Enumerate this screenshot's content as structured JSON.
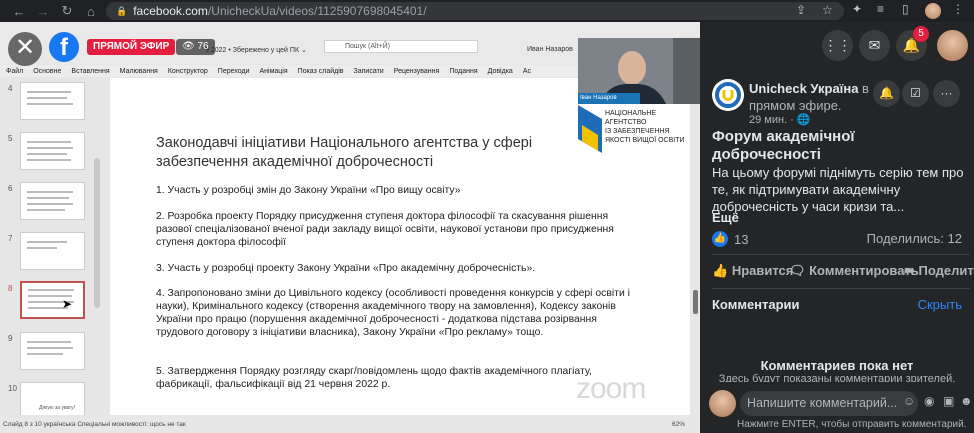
{
  "browser": {
    "url_host": "facebook.com",
    "url_path": "/UnicheckUa/videos/1125907698045401/"
  },
  "ppt": {
    "titlebar_left": "9.2022 • Збережено у цей ПК ⌄",
    "search_placeholder": "Пошук (Alt+Й)",
    "user": "Иван Назаров",
    "ribbon": [
      "Файл",
      "Основне",
      "Вставлення",
      "Малювання",
      "Конструктор",
      "Переходи",
      "Анімація",
      "Показ слайдів",
      "Записати",
      "Рецензування",
      "Подання",
      "Довідка",
      "Ас"
    ],
    "thumb_numbers": [
      "4",
      "5",
      "6",
      "7",
      "8",
      "9",
      "10"
    ],
    "camera_name": "Іван Назаров",
    "agency_text": [
      "НАЦІОНАЛЬНЕ",
      "АГЕНТСТВО",
      "ІЗ ЗАБЕЗПЕЧЕННЯ",
      "ЯКОСТІ ВИЩОЇ ОСВІТИ"
    ],
    "status_left": "Слайд 8 з 10     українська     Спеціальні можливості: щось не так",
    "status_zoom": "62%",
    "thumb10_caption": "Дякую за увагу!"
  },
  "slide": {
    "title": "Законодавчі ініціативи Національного агентства у сфері забезпечення академічної доброчесності",
    "items": [
      "1. Участь у розробці змін до Закону України «Про вищу освіту»",
      "2. Розробка проекту Порядку присудження ступеня доктора філософії та скасування рішення разової спеціалізованої вченої ради закладу вищої освіти, наукової установи про присудження ступеня доктора філософії",
      "3. Участь у розробці проекту Закону України «Про академічну доброчесність».",
      "4. Запропоновано зміни до Цивільного кодексу (особливості проведення конкурсів у сфері освіти і науки), Кримінального кодексу (створення академічного твору на замовлення), Кодексу законів України про працю (порушення академічної доброчесності - додаткова підстава розірвання трудового договору з ініціативи власника), Закону України «Про рекламу» тощо.",
      "5. Затвердження Порядку розгляду скарг/повідомлень щодо фактів академічного плагіату, фабрикації, фальсифікації від 21 червня 2022 р."
    ],
    "watermark": "zoom"
  },
  "overlay": {
    "live_label": "ПРЯМОЙ ЭФИР",
    "viewer_count": "76"
  },
  "panel": {
    "notif_count": "5",
    "page_name": "Unicheck Україна",
    "live_suffix": " в прямом эфире.",
    "time": "29 мин. · 🌐",
    "video_title": "Форум академічної доброчесності",
    "description": "На цьому форумі піднімуть серію тем про те, як підтримувати академічну доброчесність у часи кризи та...",
    "more": "Ещё",
    "like_count": "13",
    "shares": "Поделились: 12",
    "actions": [
      "Нравится",
      "Комментировать",
      "Поделиться"
    ],
    "comments_header": "Комментарии",
    "hide_label": "Скрыть",
    "empty_title": "Комментариев пока нет",
    "empty_sub": "Здесь будут показаны комментарии зрителей.",
    "comment_placeholder": "Напишите комментарий...",
    "enter_hint": "Нажмите ENTER, чтобы отправить комментарий."
  }
}
